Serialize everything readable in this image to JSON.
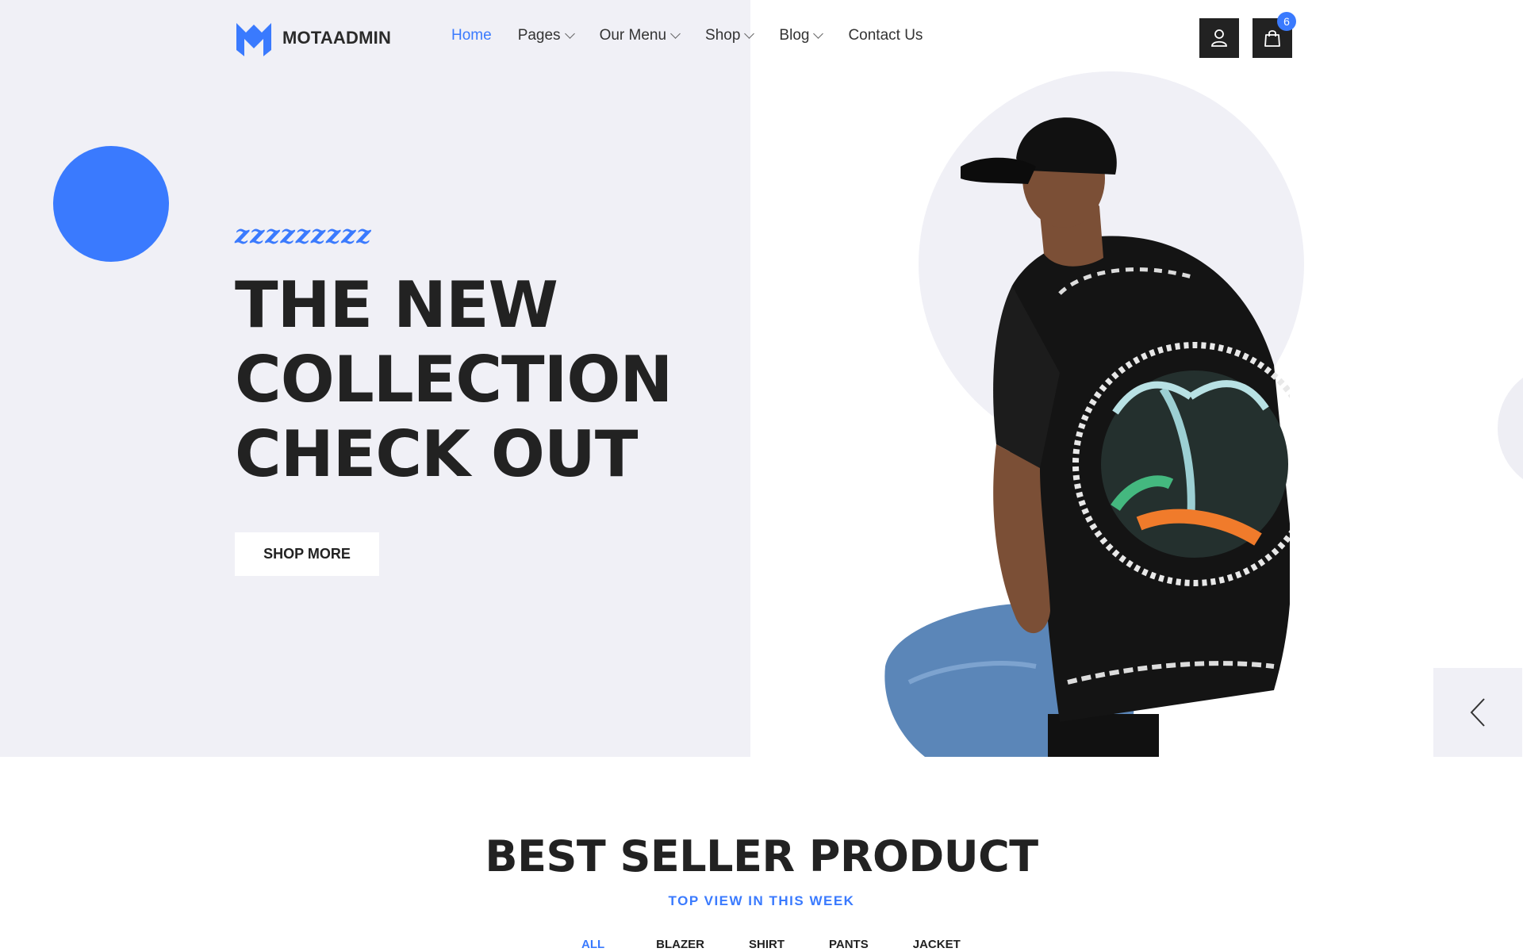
{
  "brand": {
    "name": "MOTAADMIN",
    "logo_icon": "m-logo-icon",
    "accent": "#3a7afe"
  },
  "nav": {
    "items": [
      {
        "label": "Home",
        "active": true,
        "dropdown": false
      },
      {
        "label": "Pages",
        "active": false,
        "dropdown": true
      },
      {
        "label": "Our Menu",
        "active": false,
        "dropdown": true
      },
      {
        "label": "Shop",
        "active": false,
        "dropdown": true
      },
      {
        "label": "Blog",
        "active": false,
        "dropdown": true
      },
      {
        "label": "Contact Us",
        "active": false,
        "dropdown": false
      }
    ]
  },
  "header_actions": {
    "user_icon": "user-icon",
    "cart_icon": "shopping-bag-icon",
    "cart_count": "6"
  },
  "hero": {
    "tagline": "zzzzzzzzz",
    "title_lines": [
      "THE NEW",
      "COLLECTION",
      "CHECK OUT"
    ],
    "cta_label": "SHOP MORE",
    "prev_icon": "chevron-left-icon"
  },
  "best_seller": {
    "title": "BEST SELLER PRODUCT",
    "subtitle": "TOP VIEW IN THIS WEEK",
    "filters": [
      "ALL",
      "BLAZER",
      "SHIRT",
      "PANTS",
      "JACKET"
    ],
    "active_filter": "ALL"
  }
}
